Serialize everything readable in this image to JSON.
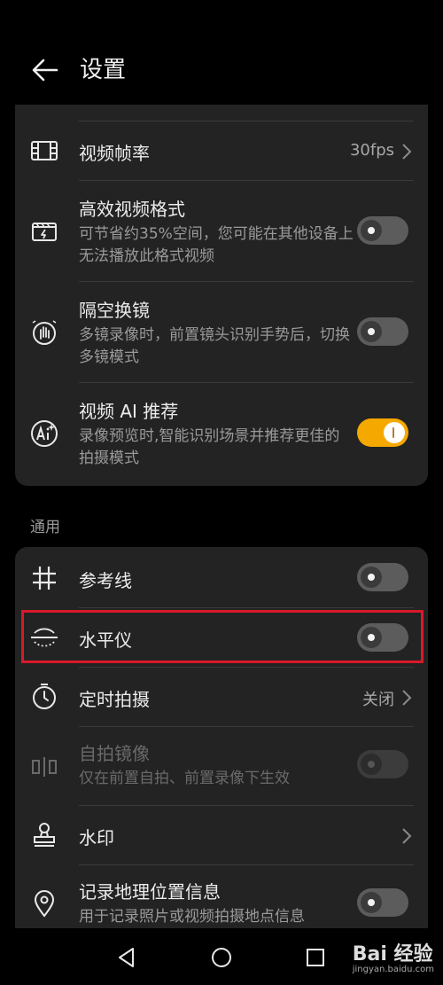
{
  "header": {
    "title": "设置"
  },
  "video_settings": {
    "frame_rate": {
      "label": "视频帧率",
      "value": "30fps"
    },
    "hevc": {
      "label": "高效视频格式",
      "desc": "可节省约35%空间，您可能在其他设备上无法播放此格式视频",
      "enabled": false
    },
    "gesture_switch": {
      "label": "隔空换镜",
      "desc": "多镜录像时，前置镜头识别手势后，切换多镜模式",
      "enabled": false
    },
    "ai_recommend": {
      "label": "视频 AI 推荐",
      "desc": "录像预览时,智能识别场景并推荐更佳的拍摄模式",
      "enabled": true
    }
  },
  "general_section": {
    "title": "通用"
  },
  "general_settings": {
    "grid": {
      "label": "参考线",
      "enabled": false
    },
    "level": {
      "label": "水平仪",
      "enabled": false
    },
    "timer": {
      "label": "定时拍摄",
      "value": "关闭"
    },
    "mirror": {
      "label": "自拍镜像",
      "desc": "仅在前置自拍、前置录像下生效",
      "enabled": false,
      "disabled": true
    },
    "watermark": {
      "label": "水印"
    },
    "location": {
      "label": "记录地理位置信息",
      "desc": "用于记录照片或视频拍摄地点信息",
      "enabled": false
    }
  },
  "watermark_overlay": {
    "brand": "Bai 经验",
    "url": "jingyan.baidu.com"
  },
  "colors": {
    "accent": "#f5a800",
    "highlight_border": "#d9192a",
    "card_bg": "#232323"
  }
}
